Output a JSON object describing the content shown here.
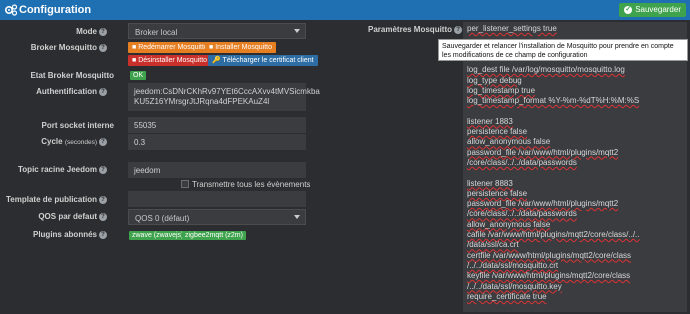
{
  "header": {
    "title": "Configuration",
    "save_label": "Sauvegarder"
  },
  "form": {
    "mode": {
      "label": "Mode",
      "value": "Broker local"
    },
    "broker": {
      "label": "Broker Mosquitto",
      "restart": "Redémarrer Mosquitto",
      "install": "Installer Mosquitto",
      "uninstall": "Désinstaller Mosquitto",
      "download_cert": "Télécharger le certificat client"
    },
    "state": {
      "label": "Etat Broker Mosquitto",
      "value": "OK"
    },
    "auth": {
      "label": "Authentification",
      "line1": "jeedom:CsDNrCKhRv97YEt6CccAXvv4tMVSicmkba",
      "line2": "KU5Z16YMrsgrJtJRqna4dFPEKAuZ4l"
    },
    "port": {
      "label": "Port socket interne",
      "value": "55035"
    },
    "cycle": {
      "label": "Cycle",
      "sublabel": "(secondes)",
      "value": "0.3"
    },
    "topic": {
      "label": "Topic racine Jeedom",
      "value": "jeedom",
      "checkbox_label": "Transmettre tous les évènements"
    },
    "template": {
      "label": "Template de publication",
      "value": ""
    },
    "qos": {
      "label": "QOS par defaut",
      "value": "QOS 0 (défaut)"
    },
    "plugins": {
      "label": "Plugins abonnés",
      "items": [
        "zwave (zwavejs)",
        "zigbee2mqtt (z2m)"
      ]
    }
  },
  "mosquitto": {
    "label": "Paramètres Mosquitto",
    "lines": [
      "per_listener_settings true",
      "",
      "",
      "",
      "log_dest file /var/log/mosquitto/mosquitto.log",
      "log_type debug",
      "log_timestamp true",
      "log_timestamp_format %Y-%m-%dT%H:%M:%S",
      "",
      "listener 1883",
      "persistence false",
      "allow_anonymous false",
      "password_file /var/www/html/plugins/mqtt2",
      "/core/class/../../data/passwords",
      "",
      "listener 8883",
      "persistence false",
      "password_file /var/www/html/plugins/mqtt2",
      "/core/class/../../data/passwords",
      "allow_anonymous false",
      "cafile /var/www/html/plugins/mqtt2/core/class/../..",
      "/data/ssl/ca.crt",
      "certfile /var/www/html/plugins/mqtt2/core/class",
      "/../../data/ssl/mosquitto.crt",
      "keyfile /var/www/html/plugins/mqtt2/core/class",
      "/../../data/ssl/mosquitto.key",
      "require_certificate true"
    ],
    "tooltip": "Sauvegarder et relancer l'installation de Mosquitto pour prendre en compte les modifications de ce champ de configuration"
  }
}
